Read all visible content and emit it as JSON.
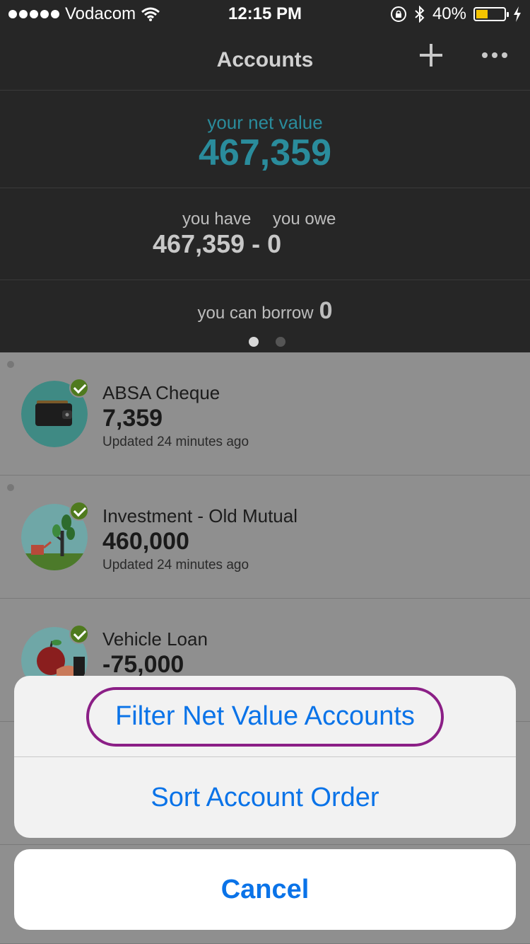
{
  "status_bar": {
    "carrier": "Vodacom",
    "time": "12:15 PM",
    "battery": "40%",
    "battery_level": 0.4
  },
  "nav": {
    "title": "Accounts",
    "add_icon": "plus-icon",
    "more_icon": "more-icon"
  },
  "summary": {
    "net_label": "your net value",
    "net_value": "467,359",
    "have_label": "you have",
    "owe_label": "you owe",
    "have_value": "467,359",
    "minus": "-",
    "owe_value": "0",
    "borrow_label": "you can borrow",
    "borrow_value": "0"
  },
  "accounts": [
    {
      "name": "ABSA Cheque",
      "amount": "7,359",
      "updated": "Updated 24 minutes ago",
      "icon": "wallet-icon"
    },
    {
      "name": "Investment - Old Mutual",
      "amount": "460,000",
      "updated": "Updated 24 minutes ago",
      "icon": "tree-icon"
    },
    {
      "name": "Vehicle Loan",
      "amount": "-75,000",
      "updated": "",
      "icon": "apple-icon"
    }
  ],
  "action_sheet": {
    "filter": "Filter Net Value Accounts",
    "sort": "Sort Account Order",
    "cancel": "Cancel"
  },
  "colors": {
    "accent_teal": "#2a8c9c",
    "ios_blue": "#0a73e8",
    "highlight_purple": "#8b1f86",
    "check_green": "#4f7a1e"
  }
}
